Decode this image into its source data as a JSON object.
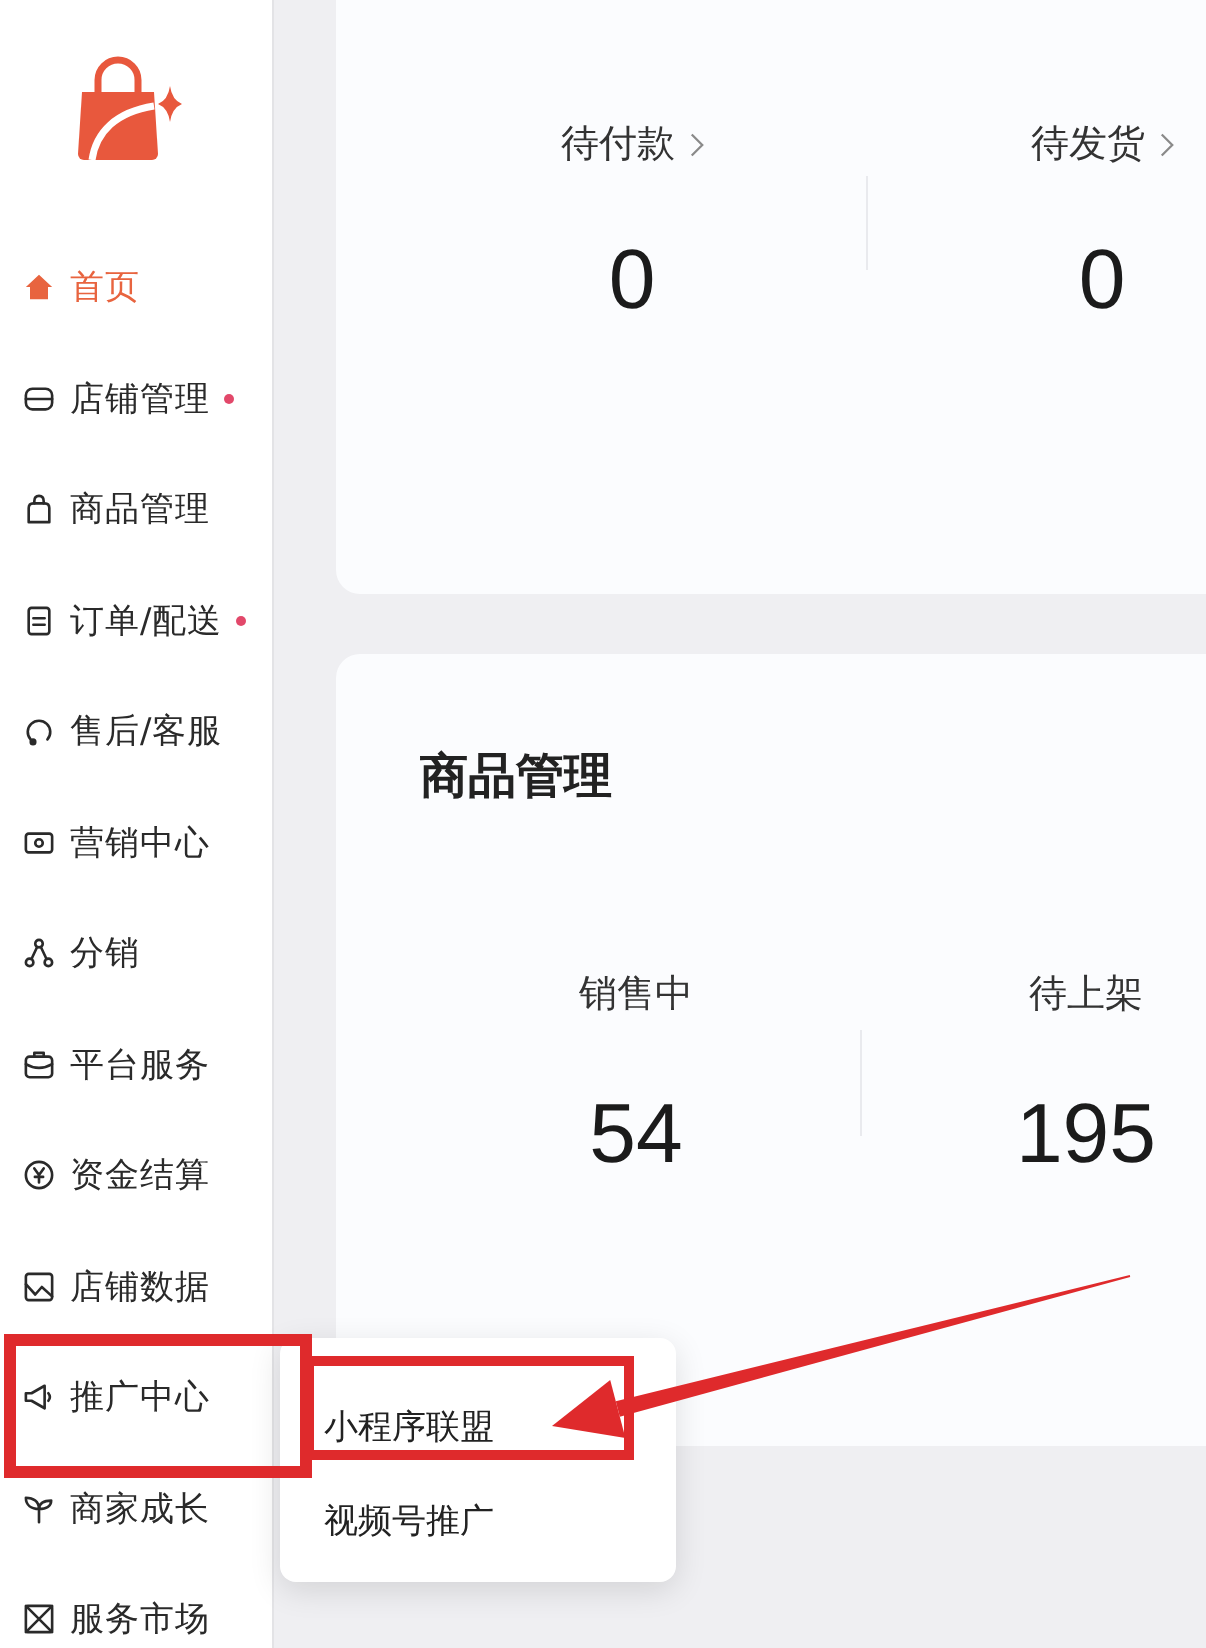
{
  "sidebar": {
    "menu": [
      {
        "label": "首页",
        "selected": true,
        "dot": false,
        "highlighted": false
      },
      {
        "label": "店铺管理",
        "selected": false,
        "dot": true,
        "highlighted": false
      },
      {
        "label": "商品管理",
        "selected": false,
        "dot": false,
        "highlighted": false
      },
      {
        "label": "订单/配送",
        "selected": false,
        "dot": true,
        "highlighted": false
      },
      {
        "label": "售后/客服",
        "selected": false,
        "dot": false,
        "highlighted": false
      },
      {
        "label": "营销中心",
        "selected": false,
        "dot": false,
        "highlighted": false
      },
      {
        "label": "分销",
        "selected": false,
        "dot": false,
        "highlighted": false
      },
      {
        "label": "平台服务",
        "selected": false,
        "dot": false,
        "highlighted": false
      },
      {
        "label": "资金结算",
        "selected": false,
        "dot": false,
        "highlighted": false
      },
      {
        "label": "店铺数据",
        "selected": false,
        "dot": false,
        "highlighted": false
      },
      {
        "label": "推广中心",
        "selected": false,
        "dot": false,
        "highlighted": true,
        "submenu": [
          {
            "label": "小程序联盟",
            "highlighted": true
          },
          {
            "label": "视频号推广",
            "highlighted": false
          }
        ]
      },
      {
        "label": "商家成长",
        "selected": false,
        "dot": false,
        "highlighted": false
      },
      {
        "label": "服务市场",
        "selected": false,
        "dot": false,
        "highlighted": false
      }
    ]
  },
  "order_card": {
    "stats": [
      {
        "label": "待付款",
        "value": "0",
        "link": true
      },
      {
        "label": "待发货",
        "value": "0",
        "link": true
      }
    ]
  },
  "product_card": {
    "title": "商品管理",
    "stats": [
      {
        "label": "销售中",
        "value": "54",
        "link": false
      },
      {
        "label": "待上架",
        "value": "195",
        "link": false
      }
    ]
  }
}
